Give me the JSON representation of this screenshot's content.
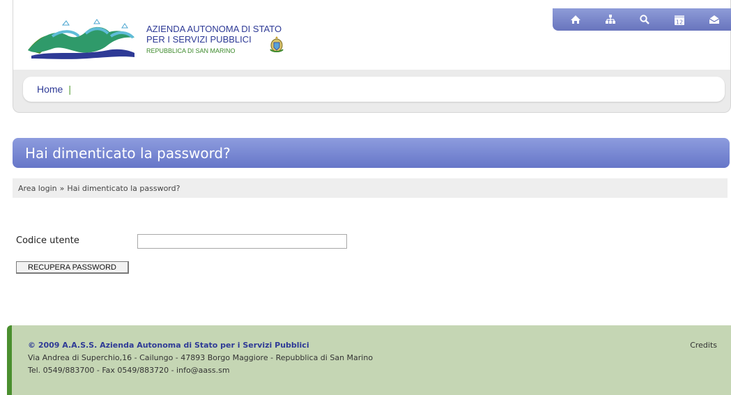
{
  "header": {
    "org_line1": "AZIENDA AUTONOMA DI STATO",
    "org_line2": "PER I SERVIZI PUBBLICI",
    "org_line3": "REPUBBLICA DI SAN MARINO",
    "icons": [
      "home-icon",
      "sitemap-icon",
      "search-icon",
      "calendar-icon",
      "mail-icon"
    ],
    "calendar_day": "12"
  },
  "nav": {
    "home_label": "Home",
    "separator": "|"
  },
  "page": {
    "title": "Hai dimenticato la password?",
    "breadcrumb_parent": "Area login",
    "breadcrumb_sep": "»",
    "breadcrumb_current": "Hai dimenticato la password?"
  },
  "form": {
    "user_code_label": "Codice utente",
    "user_code_value": "",
    "submit_label": "RECUPERA PASSWORD"
  },
  "footer": {
    "copyright": "© 2009 A.A.S.S. Azienda Autonoma di Stato per i Servizi Pubblici",
    "address": "Via Andrea di Superchio,16 - Cailungo - 47893 Borgo Maggiore - Repubblica di San Marino",
    "contacts": "Tel. 0549/883700 - Fax 0549/883720 - info@aass.sm",
    "credits": "Credits"
  },
  "colors": {
    "brand_blue": "#2e3a96",
    "title_bar": "#7483d0",
    "footer_bg": "#c5d6b4",
    "footer_accent": "#4a8f2e"
  }
}
